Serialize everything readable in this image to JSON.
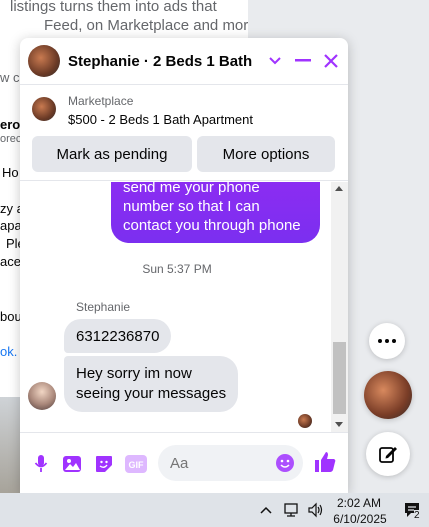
{
  "background_page": {
    "line1": "listings turns them into ads that",
    "line2": "Feed, on Marketplace and more",
    "line3": "w c",
    "line4": "ero",
    "line5": "orec",
    "line6": "Ho",
    "line7": "zy a",
    "line8": "apa",
    "line9": "Ple",
    "line10": "ace",
    "line11": "bou",
    "line12": "ok."
  },
  "chat": {
    "title": "Stephanie · 2 Beds 1 Bath ...",
    "marketplace_label": "Marketplace",
    "listing_title": "$500 - 2 Beds 1 Bath Apartment",
    "mark_pending_label": "Mark as pending",
    "more_options_label": "More options",
    "my_message_lines": [
      "send me your phone",
      "number so that I can",
      "contact you through phone"
    ],
    "timestamp": "Sun 5:37 PM",
    "sender_name": "Stephanie",
    "their_messages": [
      "6312236870",
      "Hey sorry im now\nseeing your messages"
    ],
    "composer_placeholder": "Aa",
    "accent_color": "#a033ff",
    "my_bubble_color": "#8a2bf0"
  },
  "taskbar": {
    "time": "2:02 AM",
    "date": "6/10/2025",
    "notification_count": "2"
  }
}
